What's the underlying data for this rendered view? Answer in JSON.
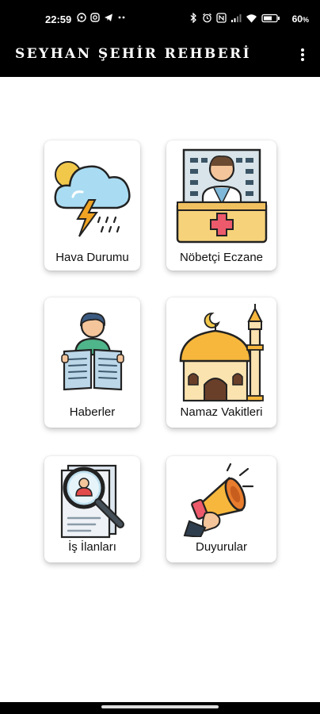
{
  "status_bar": {
    "time": "22:59",
    "left_icons": [
      "whatsapp-icon",
      "instagram-icon",
      "telegram-icon",
      "more-dots-icon"
    ],
    "right_icons": [
      "bluetooth-icon",
      "alarm-icon",
      "nfc-icon",
      "signal-icon",
      "wifi-icon",
      "battery-icon"
    ],
    "battery": "60"
  },
  "app_bar": {
    "title": "SEYHAN ŞEHİR REHBERİ",
    "menu_icon": "more-vert-icon"
  },
  "menu": [
    {
      "label": "Hava Durumu",
      "icon": "weather-storm-icon"
    },
    {
      "label": "Nöbetçi Eczane",
      "icon": "pharmacy-icon"
    },
    {
      "label": "Haberler",
      "icon": "newspaper-reader-icon"
    },
    {
      "label": "Namaz Vakitleri",
      "icon": "mosque-icon"
    },
    {
      "label": "İş İlanları",
      "icon": "job-search-icon"
    },
    {
      "label": "Duyurular",
      "icon": "megaphone-icon"
    }
  ],
  "colors": {
    "bar_background": "#000000",
    "content_background": "#ffffff",
    "card_text": "#111111"
  }
}
